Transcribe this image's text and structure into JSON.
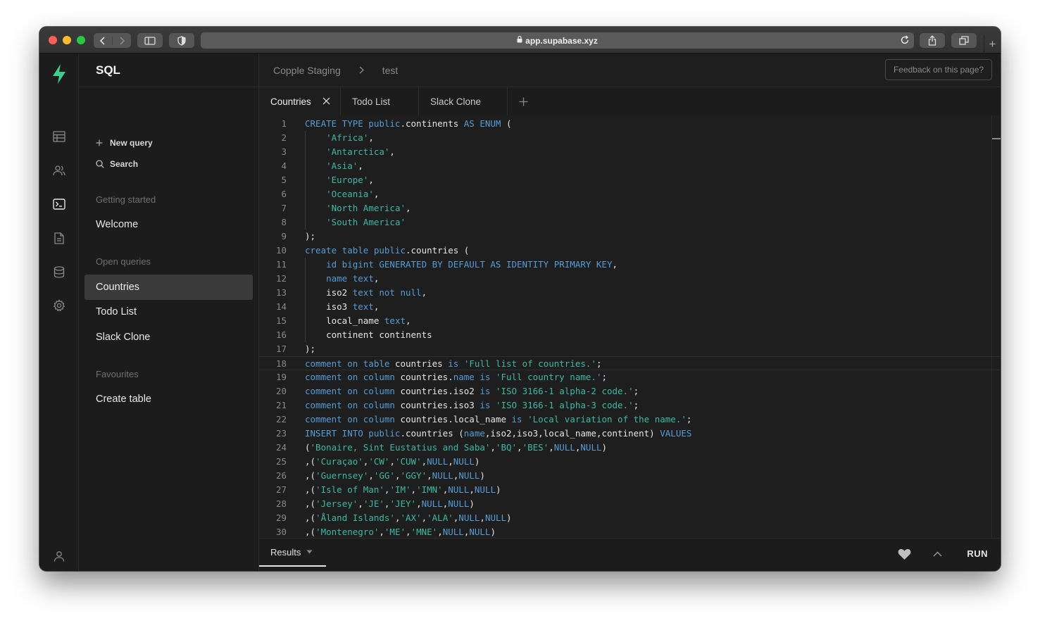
{
  "browser": {
    "url": "app.supabase.xyz",
    "icons": [
      "back-icon",
      "forward-icon",
      "sidebar-toggle-icon",
      "shield-icon",
      "lock-icon",
      "reload-icon",
      "share-icon",
      "tabs-icon",
      "new-tab-icon"
    ]
  },
  "rail": {
    "icons": [
      "supabase-logo",
      "table-editor-icon",
      "users-icon",
      "sql-terminal-icon",
      "docs-icon",
      "database-icon",
      "settings-gear-icon",
      "account-icon"
    ]
  },
  "sidebar": {
    "title": "SQL",
    "new_query_label": "New query",
    "search_label": "Search",
    "sections": {
      "getting_started": "Getting started",
      "open_queries": "Open queries",
      "favourites": "Favourites"
    },
    "getting_started_items": [
      "Welcome"
    ],
    "open_query_items": [
      "Countries",
      "Todo List",
      "Slack Clone"
    ],
    "active_item": "Countries",
    "favourite_items": [
      "Create table"
    ]
  },
  "header": {
    "breadcrumb_project": "Copple Staging",
    "breadcrumb_page": "test",
    "feedback_label": "Feedback on this page?"
  },
  "tabs": [
    {
      "label": "Countries",
      "active": true
    },
    {
      "label": "Todo List",
      "active": false
    },
    {
      "label": "Slack Clone",
      "active": false
    }
  ],
  "editor": {
    "lines": [
      [
        [
          "kw",
          "CREATE TYPE public"
        ],
        [
          "tx",
          ".continents "
        ],
        [
          "kw",
          "AS ENUM"
        ],
        [
          "tx",
          " ("
        ]
      ],
      [
        [
          "tx",
          "    "
        ],
        [
          "st",
          "'Africa'"
        ],
        [
          "tx",
          ","
        ]
      ],
      [
        [
          "tx",
          "    "
        ],
        [
          "st",
          "'Antarctica'"
        ],
        [
          "tx",
          ","
        ]
      ],
      [
        [
          "tx",
          "    "
        ],
        [
          "st",
          "'Asia'"
        ],
        [
          "tx",
          ","
        ]
      ],
      [
        [
          "tx",
          "    "
        ],
        [
          "st",
          "'Europe'"
        ],
        [
          "tx",
          ","
        ]
      ],
      [
        [
          "tx",
          "    "
        ],
        [
          "st",
          "'Oceania'"
        ],
        [
          "tx",
          ","
        ]
      ],
      [
        [
          "tx",
          "    "
        ],
        [
          "st",
          "'North America'"
        ],
        [
          "tx",
          ","
        ]
      ],
      [
        [
          "tx",
          "    "
        ],
        [
          "st",
          "'South America'"
        ]
      ],
      [
        [
          "tx",
          ");"
        ]
      ],
      [
        [
          "kw",
          "create table public"
        ],
        [
          "tx",
          ".countries ("
        ]
      ],
      [
        [
          "tx",
          "    "
        ],
        [
          "kw",
          "id bigint GENERATED BY DEFAULT AS IDENTITY PRIMARY KEY"
        ],
        [
          "tx",
          ","
        ]
      ],
      [
        [
          "tx",
          "    "
        ],
        [
          "kw",
          "name text"
        ],
        [
          "tx",
          ","
        ]
      ],
      [
        [
          "tx",
          "    iso2 "
        ],
        [
          "kw",
          "text not null"
        ],
        [
          "tx",
          ","
        ]
      ],
      [
        [
          "tx",
          "    iso3 "
        ],
        [
          "kw",
          "text"
        ],
        [
          "tx",
          ","
        ]
      ],
      [
        [
          "tx",
          "    local_name "
        ],
        [
          "kw",
          "text"
        ],
        [
          "tx",
          ","
        ]
      ],
      [
        [
          "tx",
          "    continent continents"
        ]
      ],
      [
        [
          "tx",
          ");"
        ]
      ],
      [
        [
          "kw",
          "comment on table"
        ],
        [
          "tx",
          " countries "
        ],
        [
          "kw",
          "is"
        ],
        [
          "tx",
          " "
        ],
        [
          "st",
          "'Full list of countries.'"
        ],
        [
          "tx",
          ";"
        ]
      ],
      [
        [
          "kw",
          "comment on column"
        ],
        [
          "tx",
          " countries."
        ],
        [
          "kw",
          "name is"
        ],
        [
          "tx",
          " "
        ],
        [
          "st",
          "'Full country name.'"
        ],
        [
          "tx",
          ";"
        ]
      ],
      [
        [
          "kw",
          "comment on column"
        ],
        [
          "tx",
          " countries.iso2 "
        ],
        [
          "kw",
          "is"
        ],
        [
          "tx",
          " "
        ],
        [
          "st",
          "'ISO 3166-1 alpha-2 code.'"
        ],
        [
          "tx",
          ";"
        ]
      ],
      [
        [
          "kw",
          "comment on column"
        ],
        [
          "tx",
          " countries.iso3 "
        ],
        [
          "kw",
          "is"
        ],
        [
          "tx",
          " "
        ],
        [
          "st",
          "'ISO 3166-1 alpha-3 code.'"
        ],
        [
          "tx",
          ";"
        ]
      ],
      [
        [
          "kw",
          "comment on column"
        ],
        [
          "tx",
          " countries.local_name "
        ],
        [
          "kw",
          "is"
        ],
        [
          "tx",
          " "
        ],
        [
          "st",
          "'Local variation of the name.'"
        ],
        [
          "tx",
          ";"
        ]
      ],
      [
        [
          "kw",
          "INSERT INTO public"
        ],
        [
          "tx",
          ".countries ("
        ],
        [
          "kw",
          "name"
        ],
        [
          "tx",
          ",iso2,iso3,local_name,continent) "
        ],
        [
          "kw",
          "VALUES"
        ]
      ],
      [
        [
          "tx",
          "("
        ],
        [
          "st",
          "'Bonaire, Sint Eustatius and Saba'"
        ],
        [
          "tx",
          ","
        ],
        [
          "st",
          "'BQ'"
        ],
        [
          "tx",
          ","
        ],
        [
          "st",
          "'BES'"
        ],
        [
          "tx",
          ","
        ],
        [
          "kw",
          "NULL"
        ],
        [
          "tx",
          ","
        ],
        [
          "kw",
          "NULL"
        ],
        [
          "tx",
          ")"
        ]
      ],
      [
        [
          "tx",
          ",("
        ],
        [
          "st",
          "'Curaçao'"
        ],
        [
          "tx",
          ","
        ],
        [
          "st",
          "'CW'"
        ],
        [
          "tx",
          ","
        ],
        [
          "st",
          "'CUW'"
        ],
        [
          "tx",
          ","
        ],
        [
          "kw",
          "NULL"
        ],
        [
          "tx",
          ","
        ],
        [
          "kw",
          "NULL"
        ],
        [
          "tx",
          ")"
        ]
      ],
      [
        [
          "tx",
          ",("
        ],
        [
          "st",
          "'Guernsey'"
        ],
        [
          "tx",
          ","
        ],
        [
          "st",
          "'GG'"
        ],
        [
          "tx",
          ","
        ],
        [
          "st",
          "'GGY'"
        ],
        [
          "tx",
          ","
        ],
        [
          "kw",
          "NULL"
        ],
        [
          "tx",
          ","
        ],
        [
          "kw",
          "NULL"
        ],
        [
          "tx",
          ")"
        ]
      ],
      [
        [
          "tx",
          ",("
        ],
        [
          "st",
          "'Isle of Man'"
        ],
        [
          "tx",
          ","
        ],
        [
          "st",
          "'IM'"
        ],
        [
          "tx",
          ","
        ],
        [
          "st",
          "'IMN'"
        ],
        [
          "tx",
          ","
        ],
        [
          "kw",
          "NULL"
        ],
        [
          "tx",
          ","
        ],
        [
          "kw",
          "NULL"
        ],
        [
          "tx",
          ")"
        ]
      ],
      [
        [
          "tx",
          ",("
        ],
        [
          "st",
          "'Jersey'"
        ],
        [
          "tx",
          ","
        ],
        [
          "st",
          "'JE'"
        ],
        [
          "tx",
          ","
        ],
        [
          "st",
          "'JEY'"
        ],
        [
          "tx",
          ","
        ],
        [
          "kw",
          "NULL"
        ],
        [
          "tx",
          ","
        ],
        [
          "kw",
          "NULL"
        ],
        [
          "tx",
          ")"
        ]
      ],
      [
        [
          "tx",
          ",("
        ],
        [
          "st",
          "'Åland Islands'"
        ],
        [
          "tx",
          ","
        ],
        [
          "st",
          "'AX'"
        ],
        [
          "tx",
          ","
        ],
        [
          "st",
          "'ALA'"
        ],
        [
          "tx",
          ","
        ],
        [
          "kw",
          "NULL"
        ],
        [
          "tx",
          ","
        ],
        [
          "kw",
          "NULL"
        ],
        [
          "tx",
          ")"
        ]
      ],
      [
        [
          "tx",
          ",("
        ],
        [
          "st",
          "'Montenegro'"
        ],
        [
          "tx",
          ","
        ],
        [
          "st",
          "'ME'"
        ],
        [
          "tx",
          ","
        ],
        [
          "st",
          "'MNE'"
        ],
        [
          "tx",
          ","
        ],
        [
          "kw",
          "NULL"
        ],
        [
          "tx",
          ","
        ],
        [
          "kw",
          "NULL"
        ],
        [
          "tx",
          ")"
        ]
      ]
    ],
    "highlighted_line": 18
  },
  "results": {
    "tab_label": "Results",
    "run_label": "RUN",
    "icons": [
      "heart-icon",
      "chevron-up-icon"
    ]
  },
  "colors": {
    "brand": "#3ecf8e",
    "keyword": "#569cd6",
    "string": "#3fb8a3",
    "background": "#1e1e1e"
  }
}
